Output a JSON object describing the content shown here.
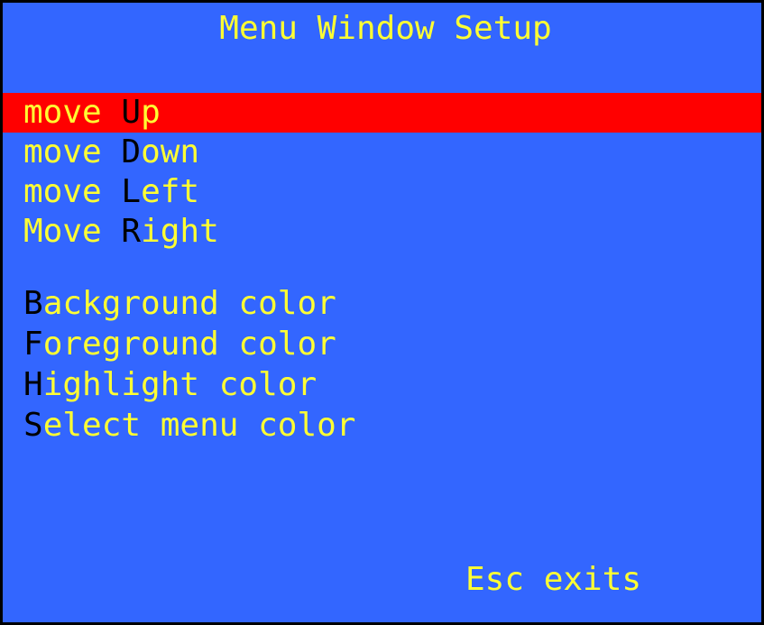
{
  "window": {
    "title": "Menu Window Setup",
    "footer": "Esc exits"
  },
  "colors": {
    "background": "#3366ff",
    "foreground": "#ffff33",
    "highlight": "#ff0000",
    "hotkey": "#000000"
  },
  "menu": {
    "position_items": [
      {
        "prefix": "move ",
        "hotkey": "U",
        "rest": "p",
        "selected": true
      },
      {
        "prefix": "move ",
        "hotkey": "D",
        "rest": "own",
        "selected": false
      },
      {
        "prefix": "move ",
        "hotkey": "L",
        "rest": "eft",
        "selected": false
      },
      {
        "prefix": "Move ",
        "hotkey": "R",
        "rest": "ight",
        "selected": false
      }
    ],
    "color_items": [
      {
        "prefix": "",
        "hotkey": "B",
        "rest": "ackground color",
        "selected": false
      },
      {
        "prefix": "",
        "hotkey": "F",
        "rest": "oreground color",
        "selected": false
      },
      {
        "prefix": "",
        "hotkey": "H",
        "rest": "ighlight color",
        "selected": false
      },
      {
        "prefix": "",
        "hotkey": "S",
        "rest": "elect menu color",
        "selected": false
      }
    ]
  }
}
